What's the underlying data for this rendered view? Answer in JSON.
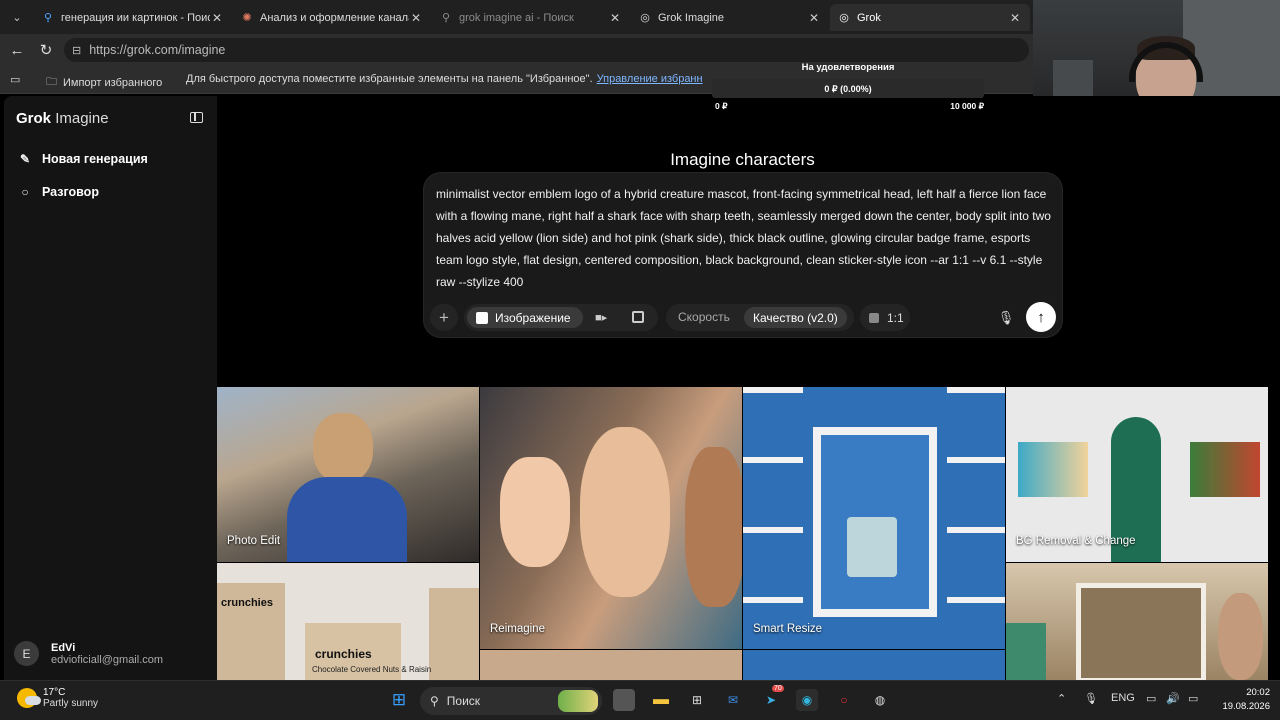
{
  "browser": {
    "tabs": [
      {
        "label": "генерация ии картинок - Поиск",
        "icon": "search-icon",
        "active": false
      },
      {
        "label": "Анализ и оформление канала Ki",
        "icon": "claude-icon",
        "active": false
      },
      {
        "label": "grok imagine ai - Поиск",
        "icon": "search-icon",
        "active": false
      },
      {
        "label": "Grok Imagine",
        "icon": "grok-icon",
        "active": false
      },
      {
        "label": "Grok",
        "icon": "grok-icon",
        "active": true
      }
    ],
    "url": "https://grok.com/imagine",
    "favorites": {
      "import_label": "Импорт избранного",
      "hint": "Для быстрого доступа поместите избранные элементы на панель \"Избранное\".",
      "manage_link": "Управление избранн"
    }
  },
  "donation": {
    "title": "На удовлетворения",
    "amount": "0 ₽ (0.00%)",
    "progress_percent": 0,
    "min": "0 ₽",
    "max": "10 000 ₽"
  },
  "sidebar": {
    "logo_bold": "Grok",
    "logo_light": "Imagine",
    "items": [
      {
        "label": "Новая генерация",
        "icon": "edit-icon"
      },
      {
        "label": "Разговор",
        "icon": "chat-icon"
      }
    ],
    "user": {
      "initial": "E",
      "name": "EdVi",
      "email": "edvioficiall@gmail.com"
    }
  },
  "main": {
    "heading": "Imagine characters",
    "prompt": "minimalist vector emblem logo of a hybrid creature mascot, front-facing symmetrical head, left half a fierce lion face with a flowing mane, right half a shark face with sharp teeth, seamlessly merged down the center, body split into two halves acid yellow (lion side) and hot pink (shark side), thick black outline, glowing circular badge frame, esports team logo style, flat design, centered composition, black background, clean sticker-style icon --ar 1:1 --v 6.1 --style raw --stylize 400",
    "toolbar": {
      "mode_image": "Изображение",
      "speed": "Скорость",
      "quality": "Качество (v2.0)",
      "ratio": "1:1"
    },
    "gallery": [
      {
        "label": "Photo Edit"
      },
      {
        "label": "Reimagine"
      },
      {
        "label": "Smart Resize"
      },
      {
        "label": "BG Removal & Change"
      },
      {
        "label": "crunchies"
      },
      {
        "label": "Chocolate Covered Nuts & Raisin"
      }
    ]
  },
  "taskbar": {
    "weather_temp": "17°C",
    "weather_desc": "Partly sunny",
    "search_placeholder": "Поиск",
    "lang": "ENG",
    "time": "20:02",
    "date": "19.08.2026",
    "badge": "70"
  },
  "colors": {
    "accent_link": "#7fb6ff",
    "background": "#000000",
    "send_button": "#ffffff"
  }
}
